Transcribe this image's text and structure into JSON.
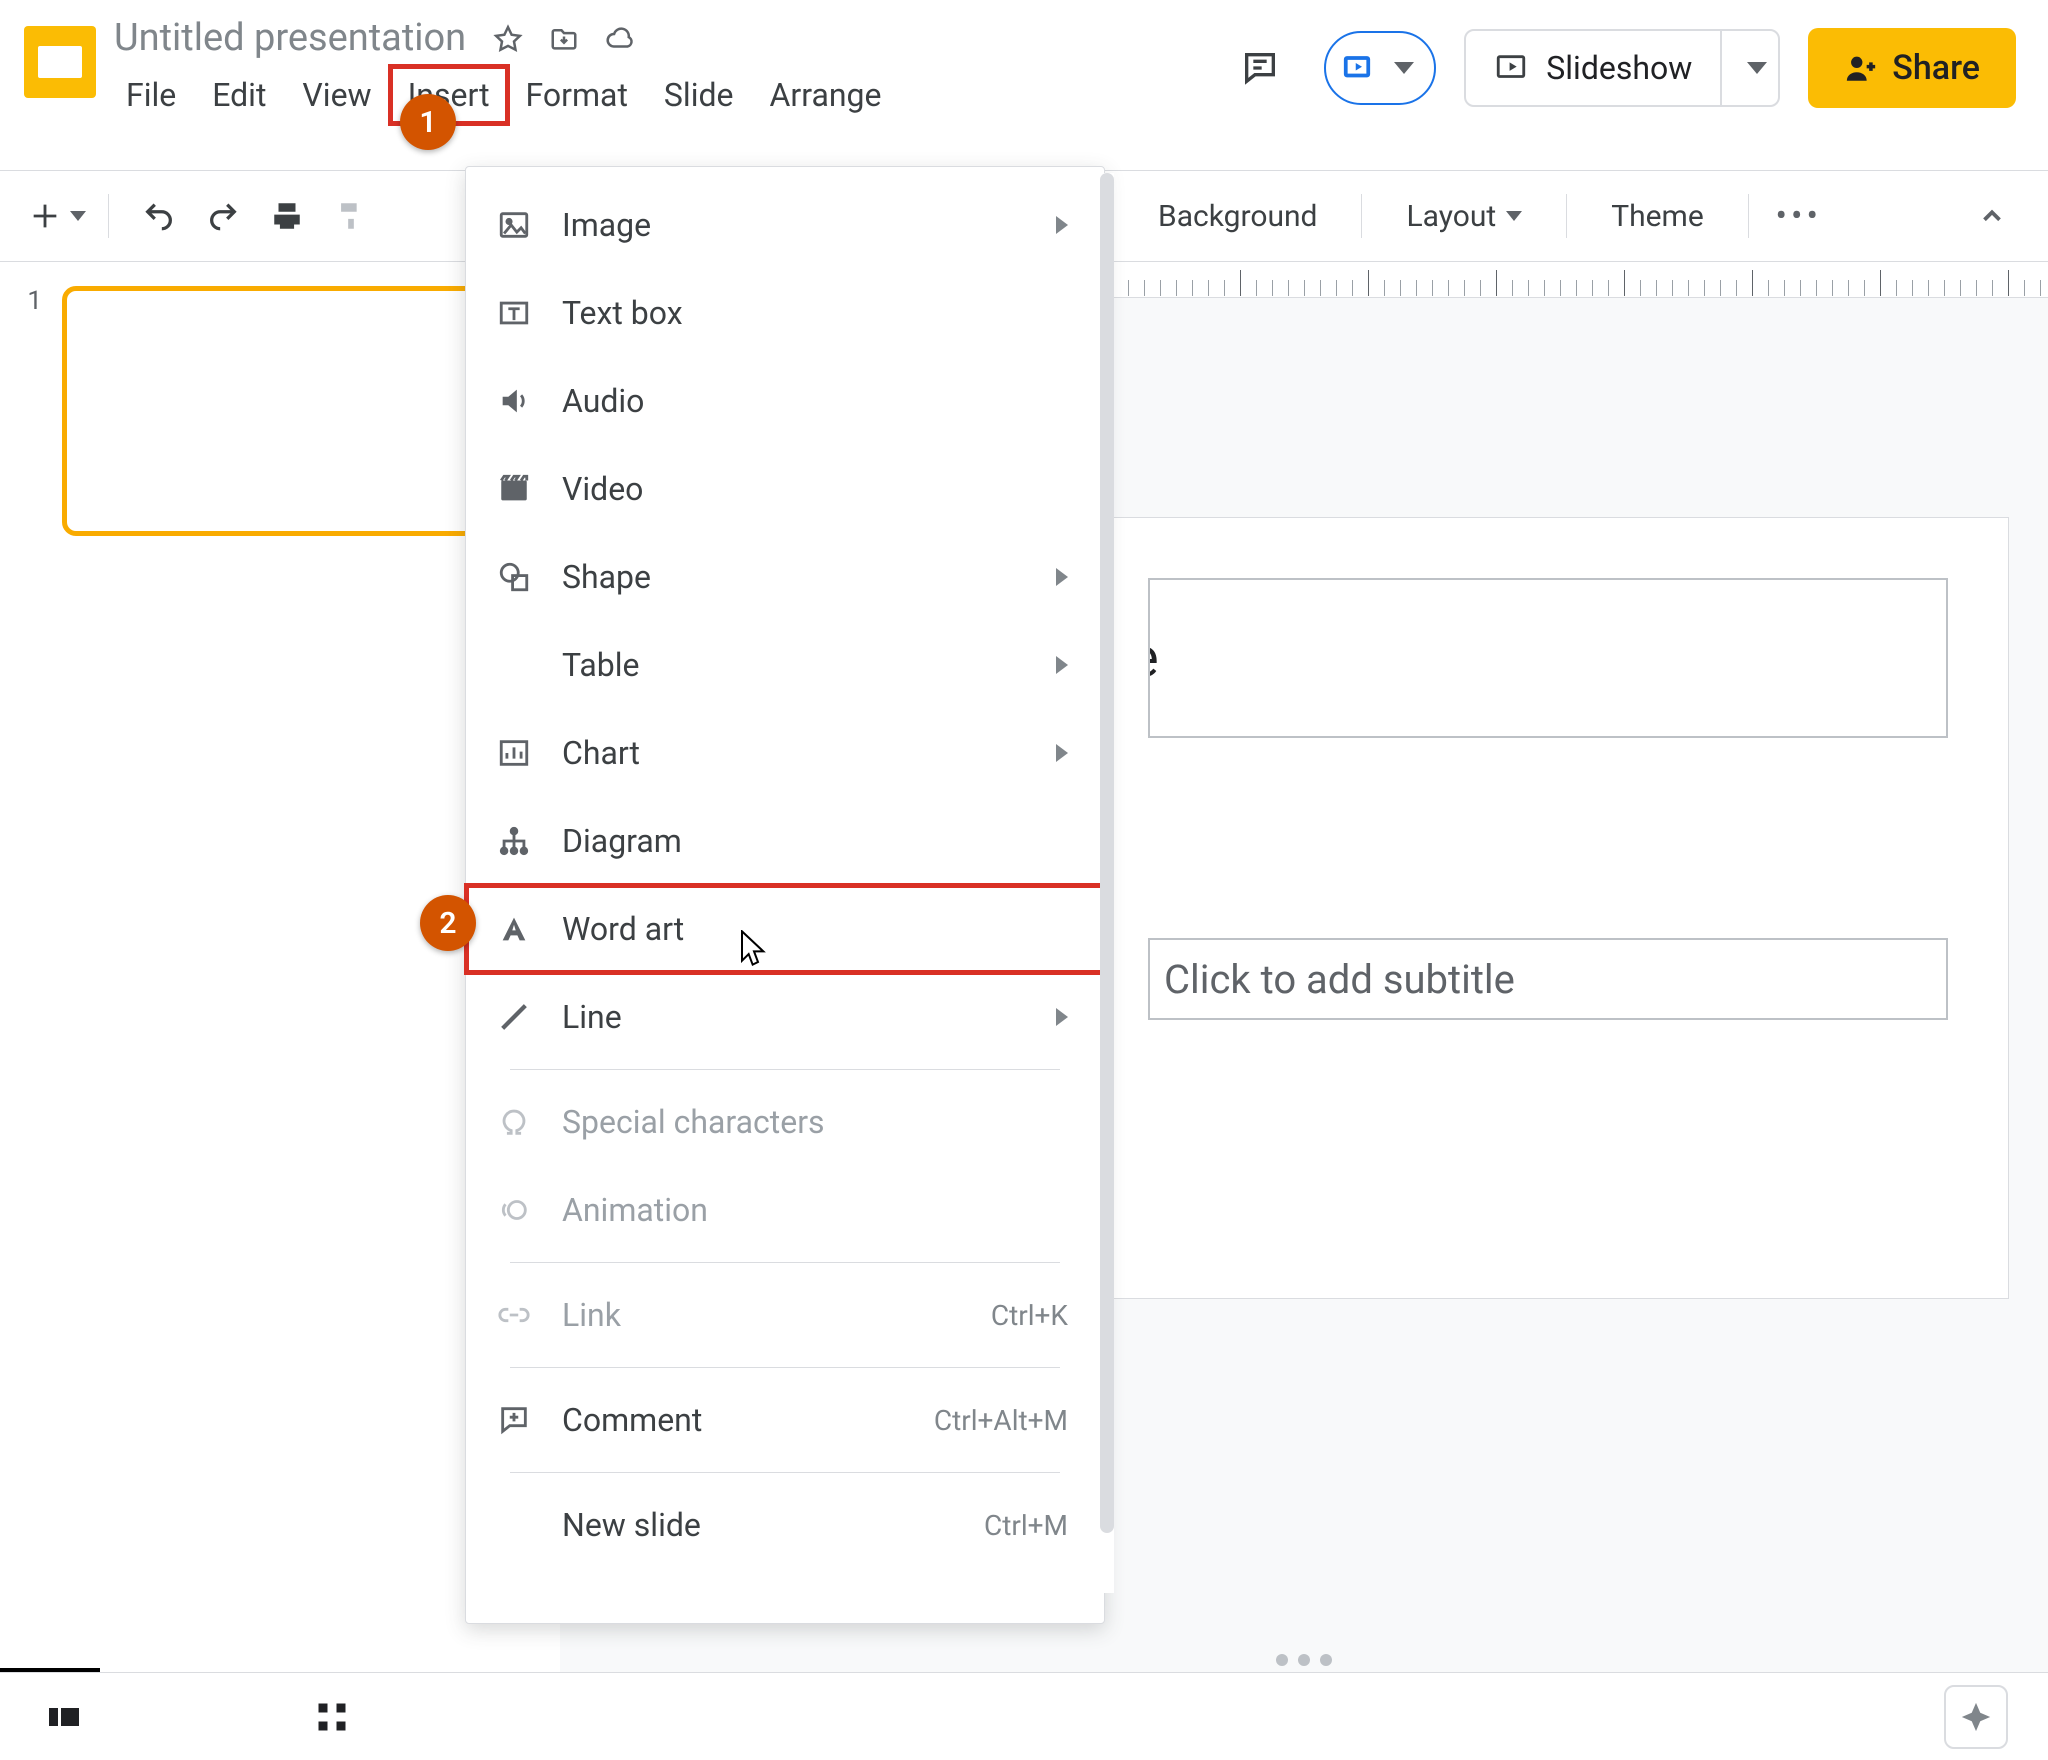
{
  "doc": {
    "name": "Untitled presentation"
  },
  "menubar": {
    "file": "File",
    "edit": "Edit",
    "view": "View",
    "insert": "Insert",
    "format": "Format",
    "slide": "Slide",
    "arrange": "Arrange"
  },
  "actions": {
    "slideshow": "Slideshow",
    "share": "Share"
  },
  "toolbar": {
    "background": "Background",
    "layout": "Layout",
    "theme": "Theme"
  },
  "insert_menu": {
    "image": "Image",
    "textbox": "Text box",
    "audio": "Audio",
    "video": "Video",
    "shape": "Shape",
    "table": "Table",
    "chart": "Chart",
    "diagram": "Diagram",
    "wordart": "Word art",
    "line": "Line",
    "special": "Special characters",
    "animation": "Animation",
    "link": "Link",
    "link_kbd": "Ctrl+K",
    "comment": "Comment",
    "comment_kbd": "Ctrl+Alt+M",
    "newslide": "New slide",
    "newslide_kbd": "Ctrl+M"
  },
  "filmstrip": {
    "slide1_num": "1"
  },
  "placeholders": {
    "title_tail": "e",
    "subtitle": "Click to add subtitle"
  },
  "steps": {
    "one": "1",
    "two": "2"
  }
}
